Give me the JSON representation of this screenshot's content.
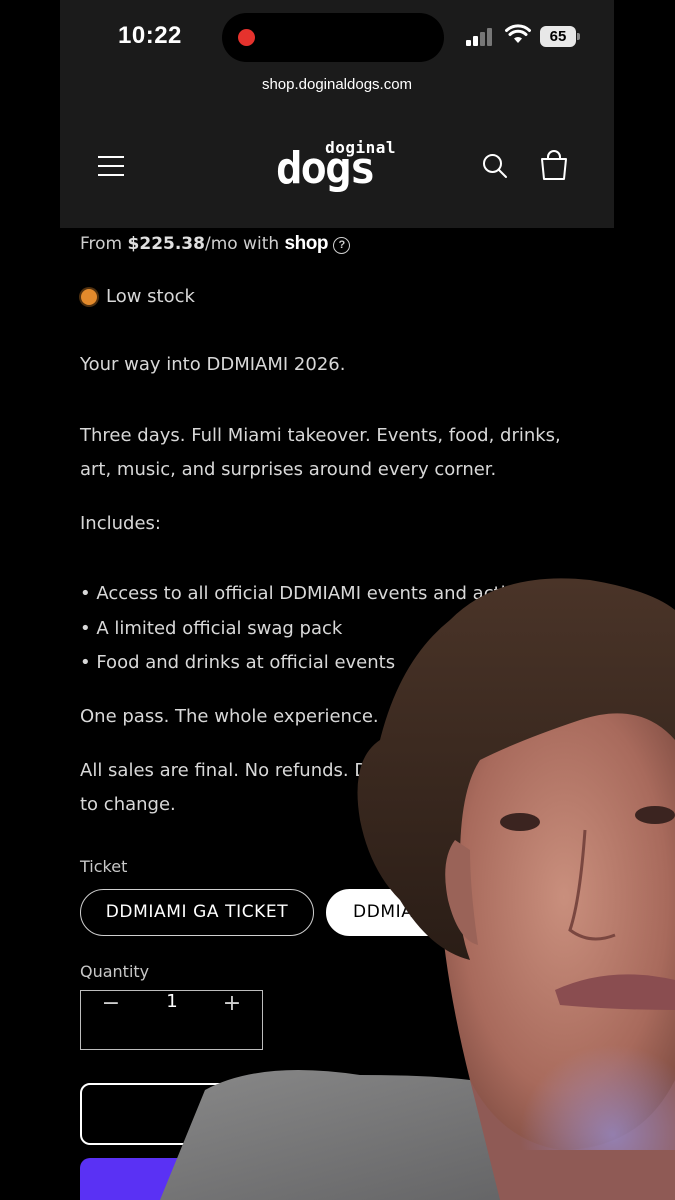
{
  "status_bar": {
    "time": "10:22",
    "battery": "65"
  },
  "browser": {
    "url": "shop.doginaldogs.com"
  },
  "header": {
    "logo_top": "doginal",
    "logo_main": "dogs"
  },
  "product": {
    "price_prefix": "From ",
    "price": "$225.38",
    "price_suffix": "/mo with ",
    "shop_label": "shop",
    "help_glyph": "?",
    "stock_status": "Low stock",
    "stock_color": "#e38a2c",
    "description": [
      "Your way into DDMIAMI 2026.",
      "Three days. Full Miami takeover. Events, food, drinks,",
      "art, music, and surprises around every corner.",
      "Includes:",
      "• Access to all official DDMIAMI events and activiti",
      "• A limited official swag pack",
      "• Food and drinks at official events",
      "One pass. The whole experience.",
      "All sales are final. No refunds. Dates",
      "to change."
    ],
    "ticket_label": "Ticket",
    "ticket_options": [
      "DDMIAMI GA TICKET",
      "DDMIA"
    ],
    "quantity_label": "Quantity",
    "quantity": "1",
    "qty_minus": "−",
    "qty_plus": "+",
    "buy_button_color": "#5a31f4"
  }
}
